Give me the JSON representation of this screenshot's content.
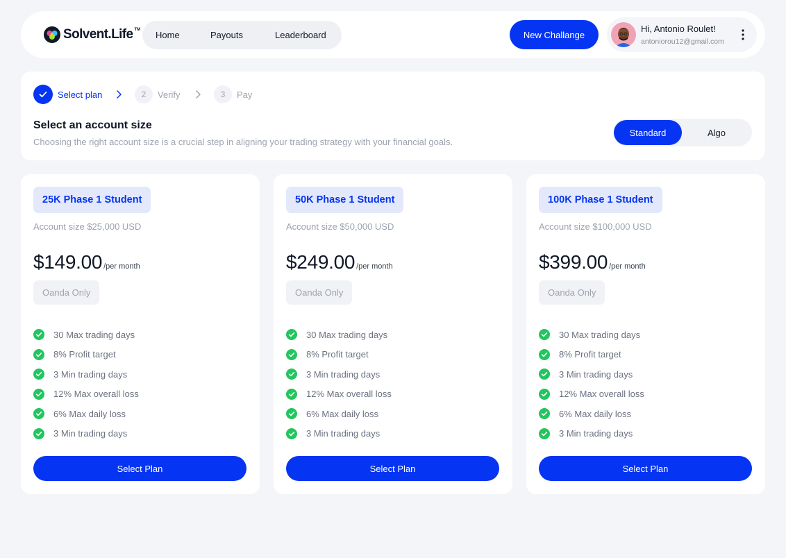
{
  "colors": {
    "accent": "#0535f2",
    "success": "#22c55e",
    "background": "#f4f5f8"
  },
  "header": {
    "brand": "Solvent.Life",
    "brand_tm": "TM",
    "nav": [
      "Home",
      "Payouts",
      "Leaderboard"
    ],
    "new_button": "New Challange",
    "user": {
      "greeting": "Hi, Antonio Roulet!",
      "email": "antoniorou12@gmail.com",
      "menu_icon": "kebab-menu-icon"
    }
  },
  "steps": {
    "items": [
      {
        "number": "",
        "label": "Select plan",
        "state": "done"
      },
      {
        "number": "2",
        "label": "Verify",
        "state": "pending"
      },
      {
        "number": "3",
        "label": "Pay",
        "state": "pending"
      }
    ],
    "title": "Select an account size",
    "description": "Choosing the right account size is a crucial step in aligning your trading strategy with your financial goals.",
    "toggle": {
      "options": [
        "Standard",
        "Algo"
      ],
      "selected": "Standard"
    }
  },
  "plans": [
    {
      "name": "25K Phase 1 Student",
      "account_size": "Account size $25,000 USD",
      "price": "$149.00",
      "period": "/per month",
      "broker": "Oanda Only",
      "features": [
        "30 Max trading days",
        "8% Profit target",
        "3 Min trading days",
        "12% Max overall loss",
        "6% Max daily loss",
        "3 Min trading days"
      ],
      "button": "Select Plan"
    },
    {
      "name": "50K Phase 1 Student",
      "account_size": "Account size $50,000 USD",
      "price": "$249.00",
      "period": "/per month",
      "broker": "Oanda Only",
      "features": [
        "30 Max trading days",
        "8% Profit target",
        "3 Min trading days",
        "12% Max overall loss",
        "6% Max daily loss",
        "3 Min trading days"
      ],
      "button": "Select Plan"
    },
    {
      "name": "100K Phase 1 Student",
      "account_size": "Account size $100,000 USD",
      "price": "$399.00",
      "period": "/per month",
      "broker": "Oanda Only",
      "features": [
        "30 Max trading days",
        "8% Profit target",
        "3 Min trading days",
        "12% Max overall loss",
        "6% Max daily loss",
        "3 Min trading days"
      ],
      "button": "Select Plan"
    }
  ]
}
